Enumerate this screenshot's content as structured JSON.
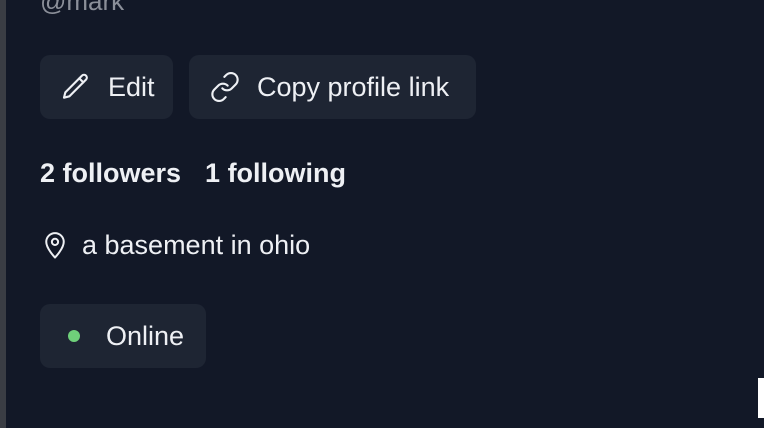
{
  "profile": {
    "handle": "@mark",
    "location": "a basement in ohio"
  },
  "actions": {
    "edit_label": "Edit",
    "copy_label": "Copy profile link"
  },
  "stats": {
    "followers": "2 followers",
    "following": "1 following"
  },
  "status": {
    "label": "Online",
    "color": "#6fd07a"
  },
  "icons": {
    "edit": "pencil-icon",
    "copy": "link-icon",
    "location": "map-pin-icon",
    "status": "online-dot"
  }
}
